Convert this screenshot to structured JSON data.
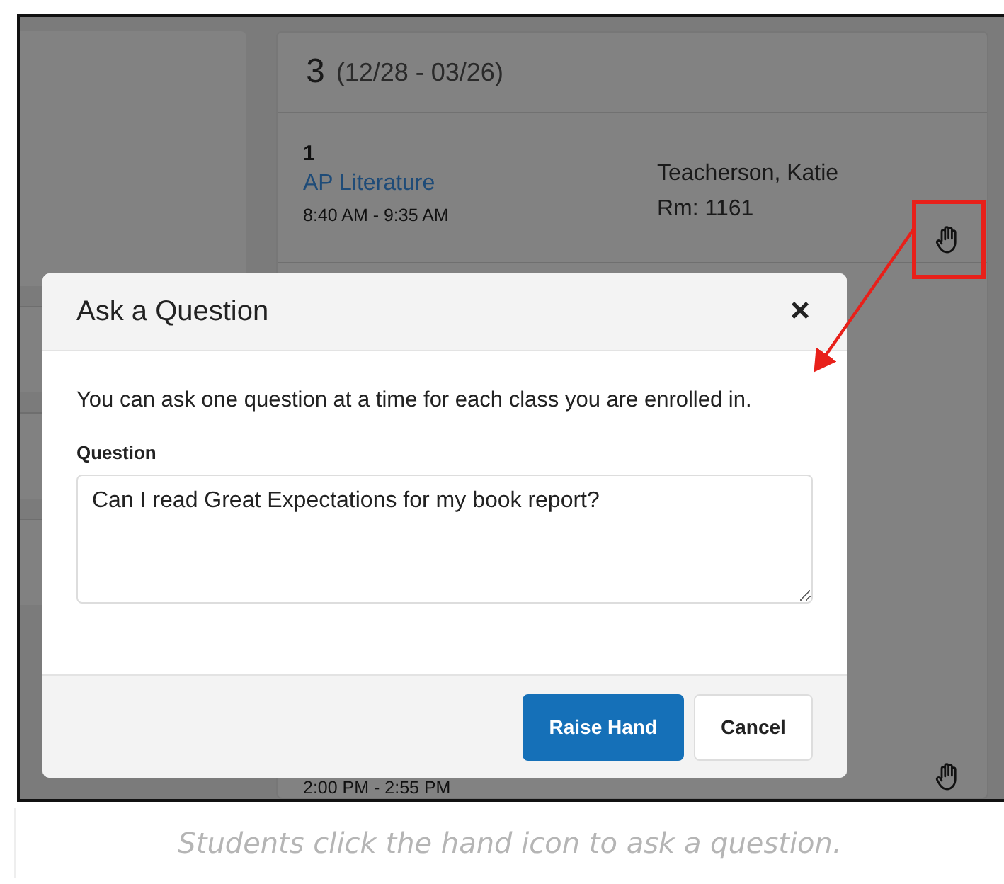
{
  "schedule": {
    "term": {
      "number": "3",
      "dates": "(12/28 - 03/26)"
    },
    "periods": [
      {
        "period": "1",
        "course": "AP Literature",
        "time": "8:40 AM - 9:35 AM",
        "teacher": "Teacherson, Katie",
        "room": "Rm: 1161",
        "annotated": true
      },
      {
        "time": "2:00 PM - 2:55 PM",
        "annotated": false
      }
    ]
  },
  "dialog": {
    "title": "Ask a Question",
    "close": "×",
    "message": "You can ask one question at a time for each class you are enrolled in.",
    "field_label": "Question",
    "value": "Can I read Great Expectations for my book report?",
    "buttons": [
      {
        "label": "Raise Hand",
        "kind": "primary"
      },
      {
        "label": "Cancel",
        "kind": "secondary"
      }
    ]
  },
  "caption": "Students click the hand icon to ask a question."
}
